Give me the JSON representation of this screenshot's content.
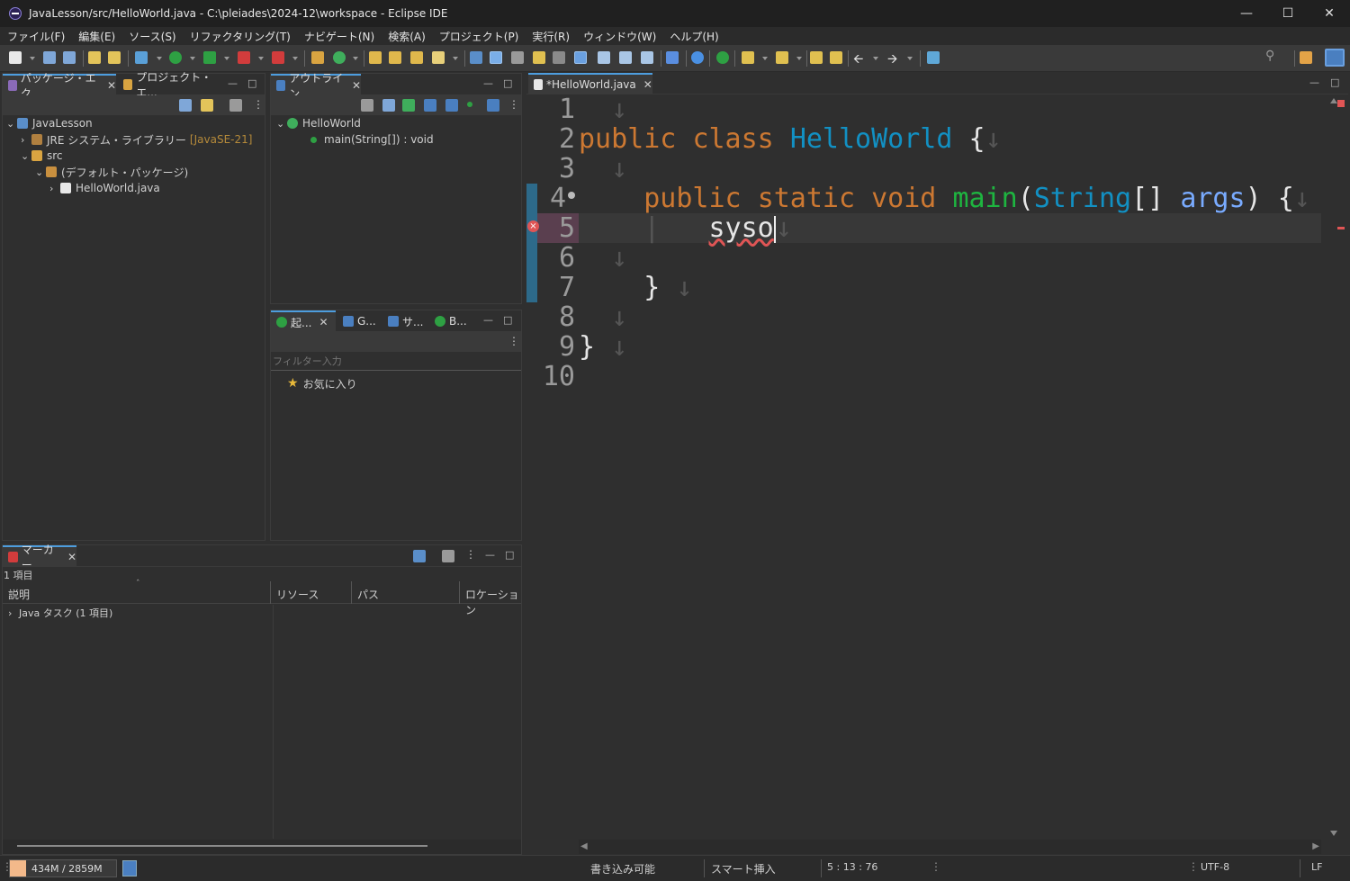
{
  "window": {
    "title": "JavaLesson/src/HelloWorld.java - C:\\pleiades\\2024-12\\workspace - Eclipse IDE"
  },
  "menu": [
    "ファイル(F)",
    "編集(E)",
    "ソース(S)",
    "リファクタリング(T)",
    "ナビゲート(N)",
    "検索(A)",
    "プロジェクト(P)",
    "実行(R)",
    "ウィンドウ(W)",
    "ヘルプ(H)"
  ],
  "package_explorer": {
    "tabs": [
      "パッケージ・エク...",
      "プロジェクト・エ..."
    ],
    "tree": [
      "JavaLesson",
      "JRE システム・ライブラリー",
      "[JavaSE-21]",
      "src",
      "(デフォルト・パッケージ)",
      "HelloWorld.java"
    ]
  },
  "outline": {
    "tab": "アウトライン",
    "items": [
      "HelloWorld",
      "main(String[]) : void"
    ]
  },
  "launch": {
    "tabs": [
      "起...",
      "G...",
      "サ...",
      "B..."
    ],
    "filter_placeholder": "フィルター入力",
    "favorites": "お気に入り"
  },
  "markers": {
    "tab": "マーカー",
    "count": "1 項目",
    "columns": [
      "説明",
      "リソース",
      "パス",
      "ロケーション"
    ],
    "rows": [
      "Java タスク (1 項目)"
    ]
  },
  "editor": {
    "tab": "*HelloWorld.java",
    "line_numbers": [
      "1",
      "2",
      "3",
      "4",
      "5",
      "6",
      "7",
      "8",
      "9",
      "10"
    ],
    "code": {
      "l2_kw1": "public",
      "l2_kw2": "class",
      "l2_cls": "HelloWorld",
      "l2_brace": "{",
      "l4_kw1": "public",
      "l4_kw2": "static",
      "l4_kw3": "void",
      "l4_mth": "main",
      "l4_open": "(",
      "l4_type": "String",
      "l4_arr": "[]",
      "l4_arg": "args",
      "l4_close": ")",
      "l4_brace": "{",
      "l5_text": "syso",
      "l7_brace": "}",
      "l9_brace": "}"
    }
  },
  "status": {
    "heap": "434M / 2859M",
    "heap_used_fraction": 0.15,
    "writable": "書き込み可能",
    "insert_mode": "スマート挿入",
    "position": "5 : 13 : 76",
    "encoding": "UTF-8",
    "line_ending": "LF"
  },
  "colors": {
    "keyword": "#cc7832",
    "class": "#1290c3",
    "method": "#1eb540",
    "arg": "#79abff",
    "accent": "#4d9dde",
    "error": "#e05555"
  }
}
